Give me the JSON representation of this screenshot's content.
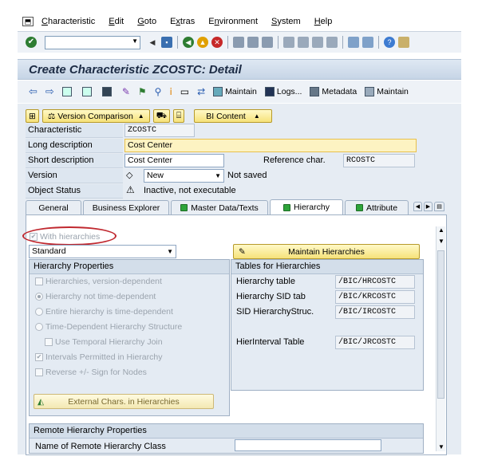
{
  "menu": [
    "Characteristic",
    "Edit",
    "Goto",
    "Extras",
    "Environment",
    "System",
    "Help"
  ],
  "menu_underline": [
    "C",
    "E",
    "G",
    "x",
    "n",
    "S",
    "H"
  ],
  "title": "Create Characteristic ZCOSTC: Detail",
  "app_toolbar": {
    "maintain": "Maintain",
    "logs": "Logs...",
    "metadata": "Metadata",
    "maintain2": "Maintain"
  },
  "buttons": {
    "version_comparison": "Version Comparison",
    "bi_content": "BI Content"
  },
  "header": {
    "characteristic_label": "Characteristic",
    "characteristic_value": "ZCOSTC",
    "long_desc_label": "Long description",
    "long_desc_value": "Cost Center",
    "short_desc_label": "Short description",
    "short_desc_value": "Cost Center",
    "ref_char_label": "Reference char.",
    "ref_char_value": "RCOSTC",
    "version_label": "Version",
    "version_value": "New",
    "version_status": "Not saved",
    "object_status_label": "Object Status",
    "object_status_value": "Inactive, not executable"
  },
  "tabs": [
    "General",
    "Business Explorer",
    "Master Data/Texts",
    "Hierarchy",
    "Attribute"
  ],
  "hierarchy": {
    "with_hierarchies": "With hierarchies",
    "type_value": "Standard",
    "props_title": "Hierarchy Properties",
    "opt_version_dependent": "Hierarchies, version-dependent",
    "opt_not_time_dependent": "Hierarchy not time-dependent",
    "opt_entire_time_dependent": "Entire hierarchy is time-dependent",
    "opt_time_dependent_structure": "Time-Dependent Hierarchy Structure",
    "opt_temporal_join": "Use Temporal Hierarchy Join",
    "opt_intervals": "Intervals Permitted in Hierarchy",
    "opt_reverse_sign": "Reverse +/- Sign for Nodes",
    "external_chars_btn": "External Chars. in Hierarchies",
    "maintain_btn": "Maintain Hierarchies",
    "tables_title": "Tables for Hierarchies",
    "hier_table_label": "Hierarchy table",
    "hier_table_value": "/BIC/HRCOSTC",
    "sid_tab_label": "Hierarchy SID tab",
    "sid_tab_value": "/BIC/KRCOSTC",
    "sid_struc_label": "SID HierarchyStruc.",
    "sid_struc_value": "/BIC/IRCOSTC",
    "interval_label": "HierInterval Table",
    "interval_value": "/BIC/JRCOSTC",
    "remote_title": "Remote Hierarchy Properties",
    "remote_class_label": "Name of Remote Hierarchy Class"
  }
}
